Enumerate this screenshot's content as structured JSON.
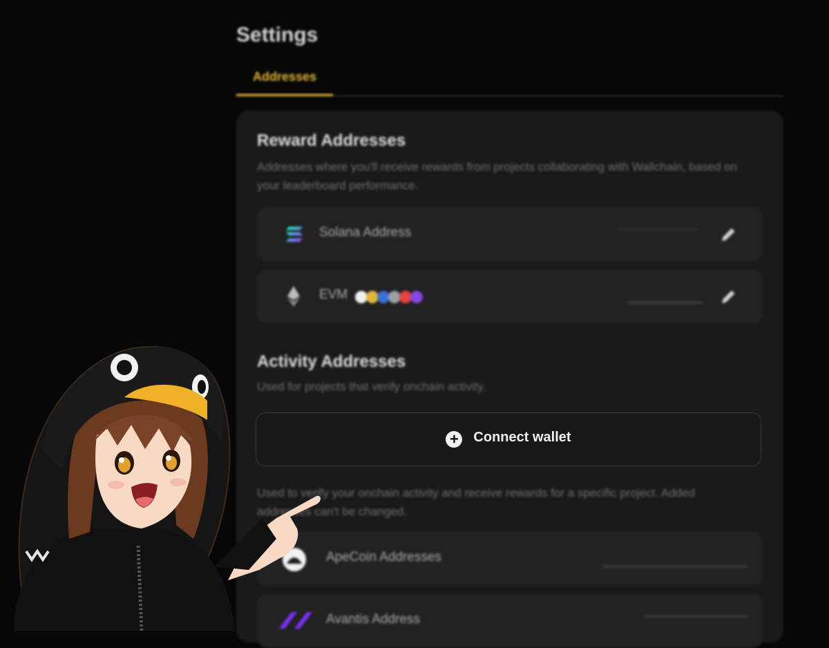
{
  "page": {
    "title": "Settings"
  },
  "tabs": [
    {
      "label": "Addresses",
      "active": true
    }
  ],
  "colors": {
    "accent": "#e2b53a",
    "background": "#070707",
    "card": "#1a1a1a",
    "row": "#222222"
  },
  "reward": {
    "title": "Reward Addresses",
    "description": "Addresses where you'll receive rewards from projects collaborating with Wallchain, based on your leaderboard performance.",
    "rows": [
      {
        "label": "Solana Address",
        "icon": "solana-icon"
      },
      {
        "label": "EVM",
        "icon": "ethereum-icon",
        "chain_icons": [
          "#f0f0f0",
          "#e2b53a",
          "#3b6fd8",
          "#9aa0a6",
          "#e84142",
          "#8247e5"
        ]
      }
    ]
  },
  "activity": {
    "title": "Activity Addresses",
    "description": "Used for projects that verify onchain activity.",
    "connect_label": "Connect wallet",
    "note": "Used to verify your onchain activity and receive rewards for a specific project. Added addresses can't be changed.",
    "rows": [
      {
        "label": "ApeCoin Addresses",
        "icon": "apecoin-icon"
      },
      {
        "label": "Avantis Address",
        "icon": "avantis-icon"
      }
    ]
  }
}
